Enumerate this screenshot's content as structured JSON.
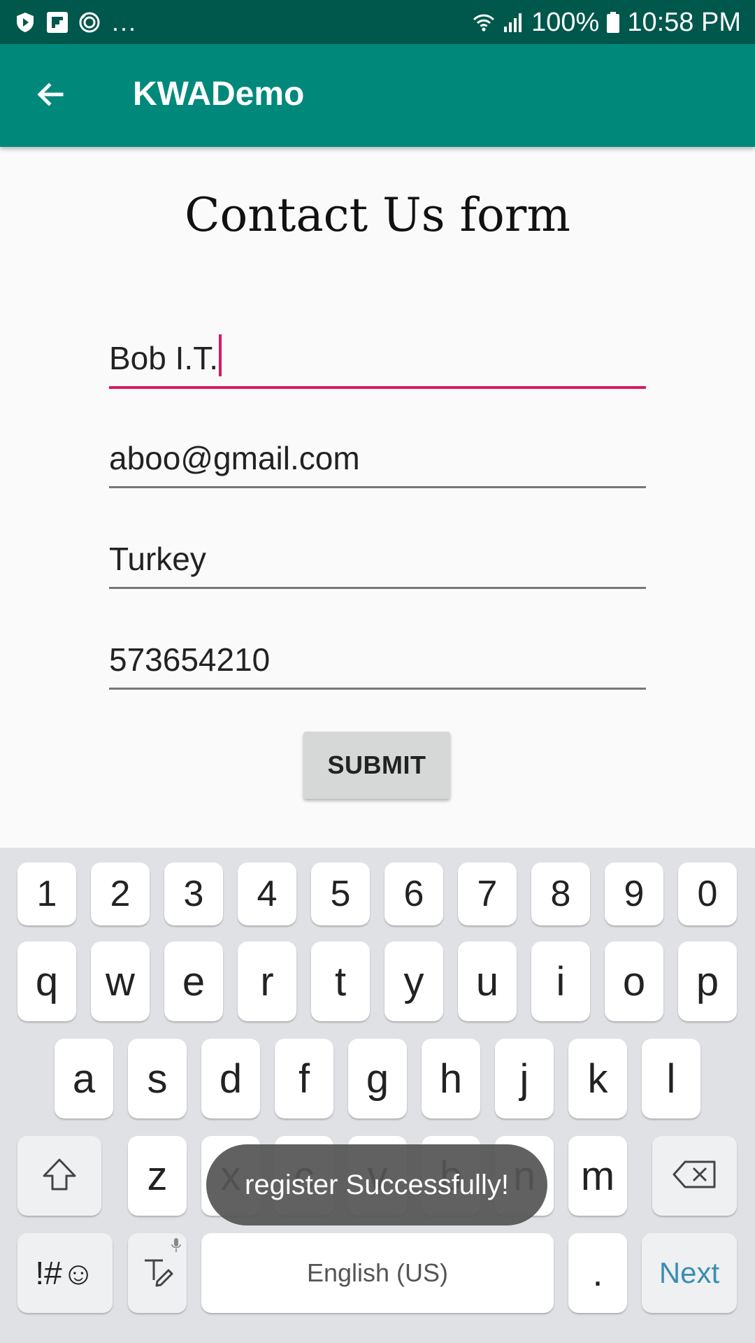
{
  "status_bar": {
    "notifications": [
      "shield-play-icon",
      "flipboard-icon",
      "sync-icon"
    ],
    "more": "...",
    "battery": "100%",
    "time": "10:58 PM"
  },
  "app_bar": {
    "title": "KWADemo"
  },
  "form": {
    "title": "Contact Us form",
    "fields": [
      {
        "value": "Bob I.T.",
        "active": true
      },
      {
        "value": "aboo@gmail.com"
      },
      {
        "value": "Turkey"
      },
      {
        "value": "573654210"
      }
    ],
    "submit_label": "SUBMIT"
  },
  "keyboard": {
    "number_row": [
      "1",
      "2",
      "3",
      "4",
      "5",
      "6",
      "7",
      "8",
      "9",
      "0"
    ],
    "row1": [
      "q",
      "w",
      "e",
      "r",
      "t",
      "y",
      "u",
      "i",
      "o",
      "p"
    ],
    "row2": [
      "a",
      "s",
      "d",
      "f",
      "g",
      "h",
      "j",
      "k",
      "l"
    ],
    "row3": [
      "z",
      "x",
      "c",
      "v",
      "b",
      "n",
      "m"
    ],
    "symbols_label": "!#☺",
    "space_label": "English (US)",
    "period_label": ".",
    "action_label": "Next"
  },
  "toast": {
    "message": "register Successfully!"
  },
  "colors": {
    "status_bar": "#00574b",
    "app_bar": "#00897b",
    "accent": "#d81b60"
  }
}
